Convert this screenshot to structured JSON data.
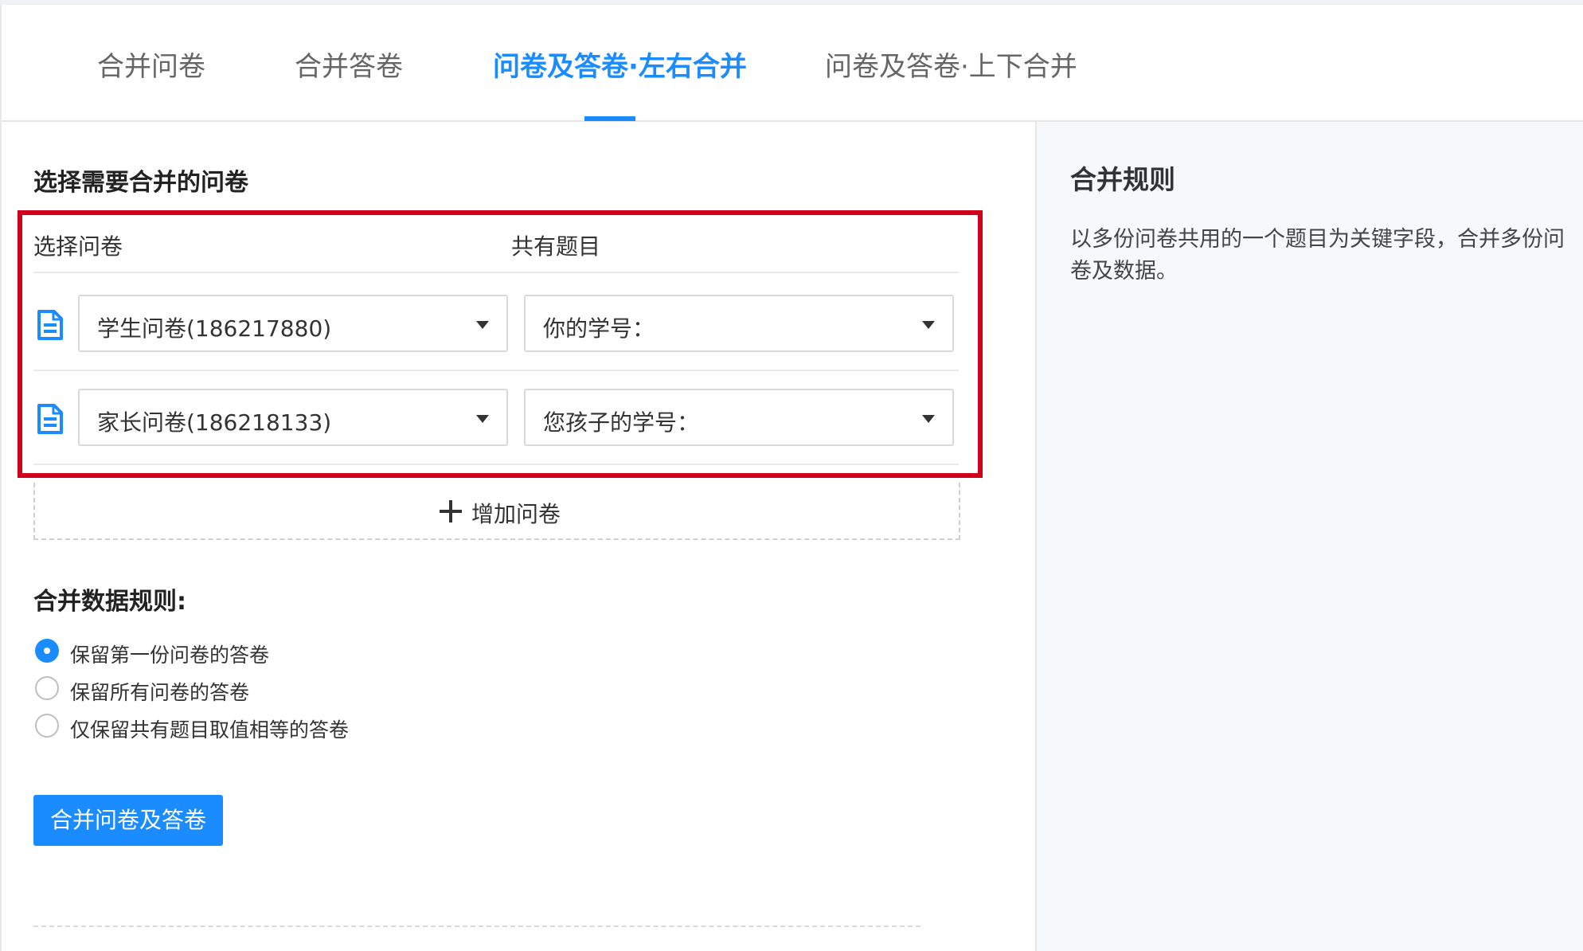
{
  "tabs": [
    {
      "label": "合并问卷",
      "active": false
    },
    {
      "label": "合并答卷",
      "active": false
    },
    {
      "label": "问卷及答卷·左右合并",
      "active": true
    },
    {
      "label": "问卷及答卷·上下合并",
      "active": false
    }
  ],
  "main": {
    "section_title": "选择需要合并的问卷",
    "columns": {
      "survey": "选择问卷",
      "common_question": "共有题目"
    },
    "rows": [
      {
        "icon": "document-icon",
        "survey": "学生问卷(186217880)",
        "question": "你的学号："
      },
      {
        "icon": "document-icon",
        "survey": "家长问卷(186218133)",
        "question": "您孩子的学号："
      }
    ],
    "add_survey_label": "增加问卷",
    "merge_rules_title": "合并数据规则:",
    "merge_rules": [
      {
        "label": "保留第一份问卷的答卷",
        "checked": true
      },
      {
        "label": "保留所有问卷的答卷",
        "checked": false
      },
      {
        "label": "仅保留共有题目取值相等的答卷",
        "checked": false
      }
    ],
    "submit_label": "合并问卷及答卷"
  },
  "side": {
    "title": "合并规则",
    "description": "以多份问卷共用的一个题目为关键字段，合并多份问卷及数据。"
  },
  "colors": {
    "accent": "#1a8cff",
    "highlight_border": "#d0021b"
  }
}
